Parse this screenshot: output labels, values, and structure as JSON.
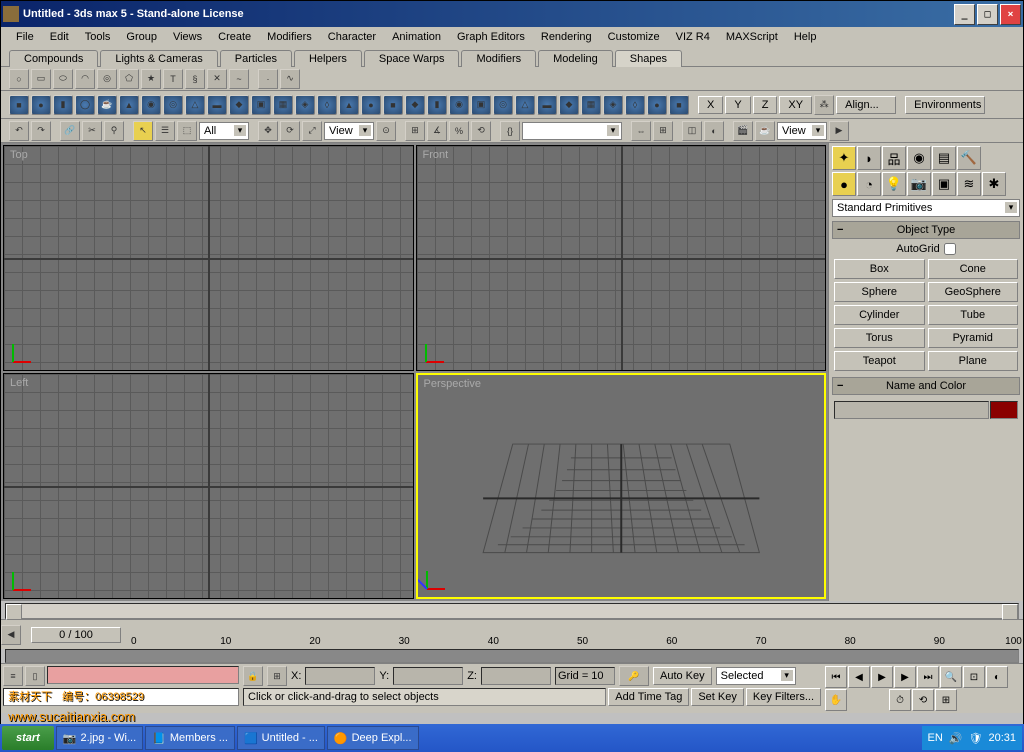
{
  "window": {
    "title": "Untitled - 3ds max 5 - Stand-alone License"
  },
  "menu": [
    "File",
    "Edit",
    "Tools",
    "Group",
    "Views",
    "Create",
    "Modifiers",
    "Character",
    "Animation",
    "Graph Editors",
    "Rendering",
    "Customize",
    "VIZ R4",
    "MAXScript",
    "Help"
  ],
  "tabs": [
    "Compounds",
    "Lights & Cameras",
    "Particles",
    "Helpers",
    "Space Warps",
    "Modifiers",
    "Modeling",
    "Shapes"
  ],
  "active_tab": "Shapes",
  "toolbar2": {
    "axis": [
      "X",
      "Y",
      "Z",
      "XY"
    ],
    "align": "Align...",
    "env": "Environments"
  },
  "toolbar3": {
    "selfilter": "All",
    "refcoord": "View",
    "view2": "View"
  },
  "viewports": {
    "top": "Top",
    "front": "Front",
    "left": "Left",
    "persp": "Perspective"
  },
  "sidepanel": {
    "dropdown": "Standard Primitives",
    "objtype_hdr": "Object Type",
    "autogrid": "AutoGrid",
    "buttons": [
      "Box",
      "Cone",
      "Sphere",
      "GeoSphere",
      "Cylinder",
      "Tube",
      "Torus",
      "Pyramid",
      "Teapot",
      "Plane"
    ],
    "namecolor_hdr": "Name and Color"
  },
  "timeline": {
    "slider": "0 / 100",
    "ticks": [
      "0",
      "10",
      "20",
      "30",
      "40",
      "50",
      "60",
      "70",
      "80",
      "90",
      "100"
    ]
  },
  "bottom": {
    "coords": {
      "x": "X:",
      "y": "Y:",
      "z": "Z:",
      "grid": "Grid = 10"
    },
    "status": "Click or click-and-drag to select objects",
    "addtag": "Add Time Tag",
    "autokey": "Auto Key",
    "setkey": "Set Key",
    "selected": "Selected",
    "keyfilters": "Key Filters..."
  },
  "taskbar": {
    "items": [
      "2.jpg - Wi...",
      "Members ...",
      "Untitled - ...",
      "Deep Expl..."
    ],
    "lang": "EN",
    "time": "20:31"
  },
  "watermark": {
    "line1": "素材天下",
    "line2": "www.sucaitianxia.com",
    "id": "编号：06398529"
  }
}
